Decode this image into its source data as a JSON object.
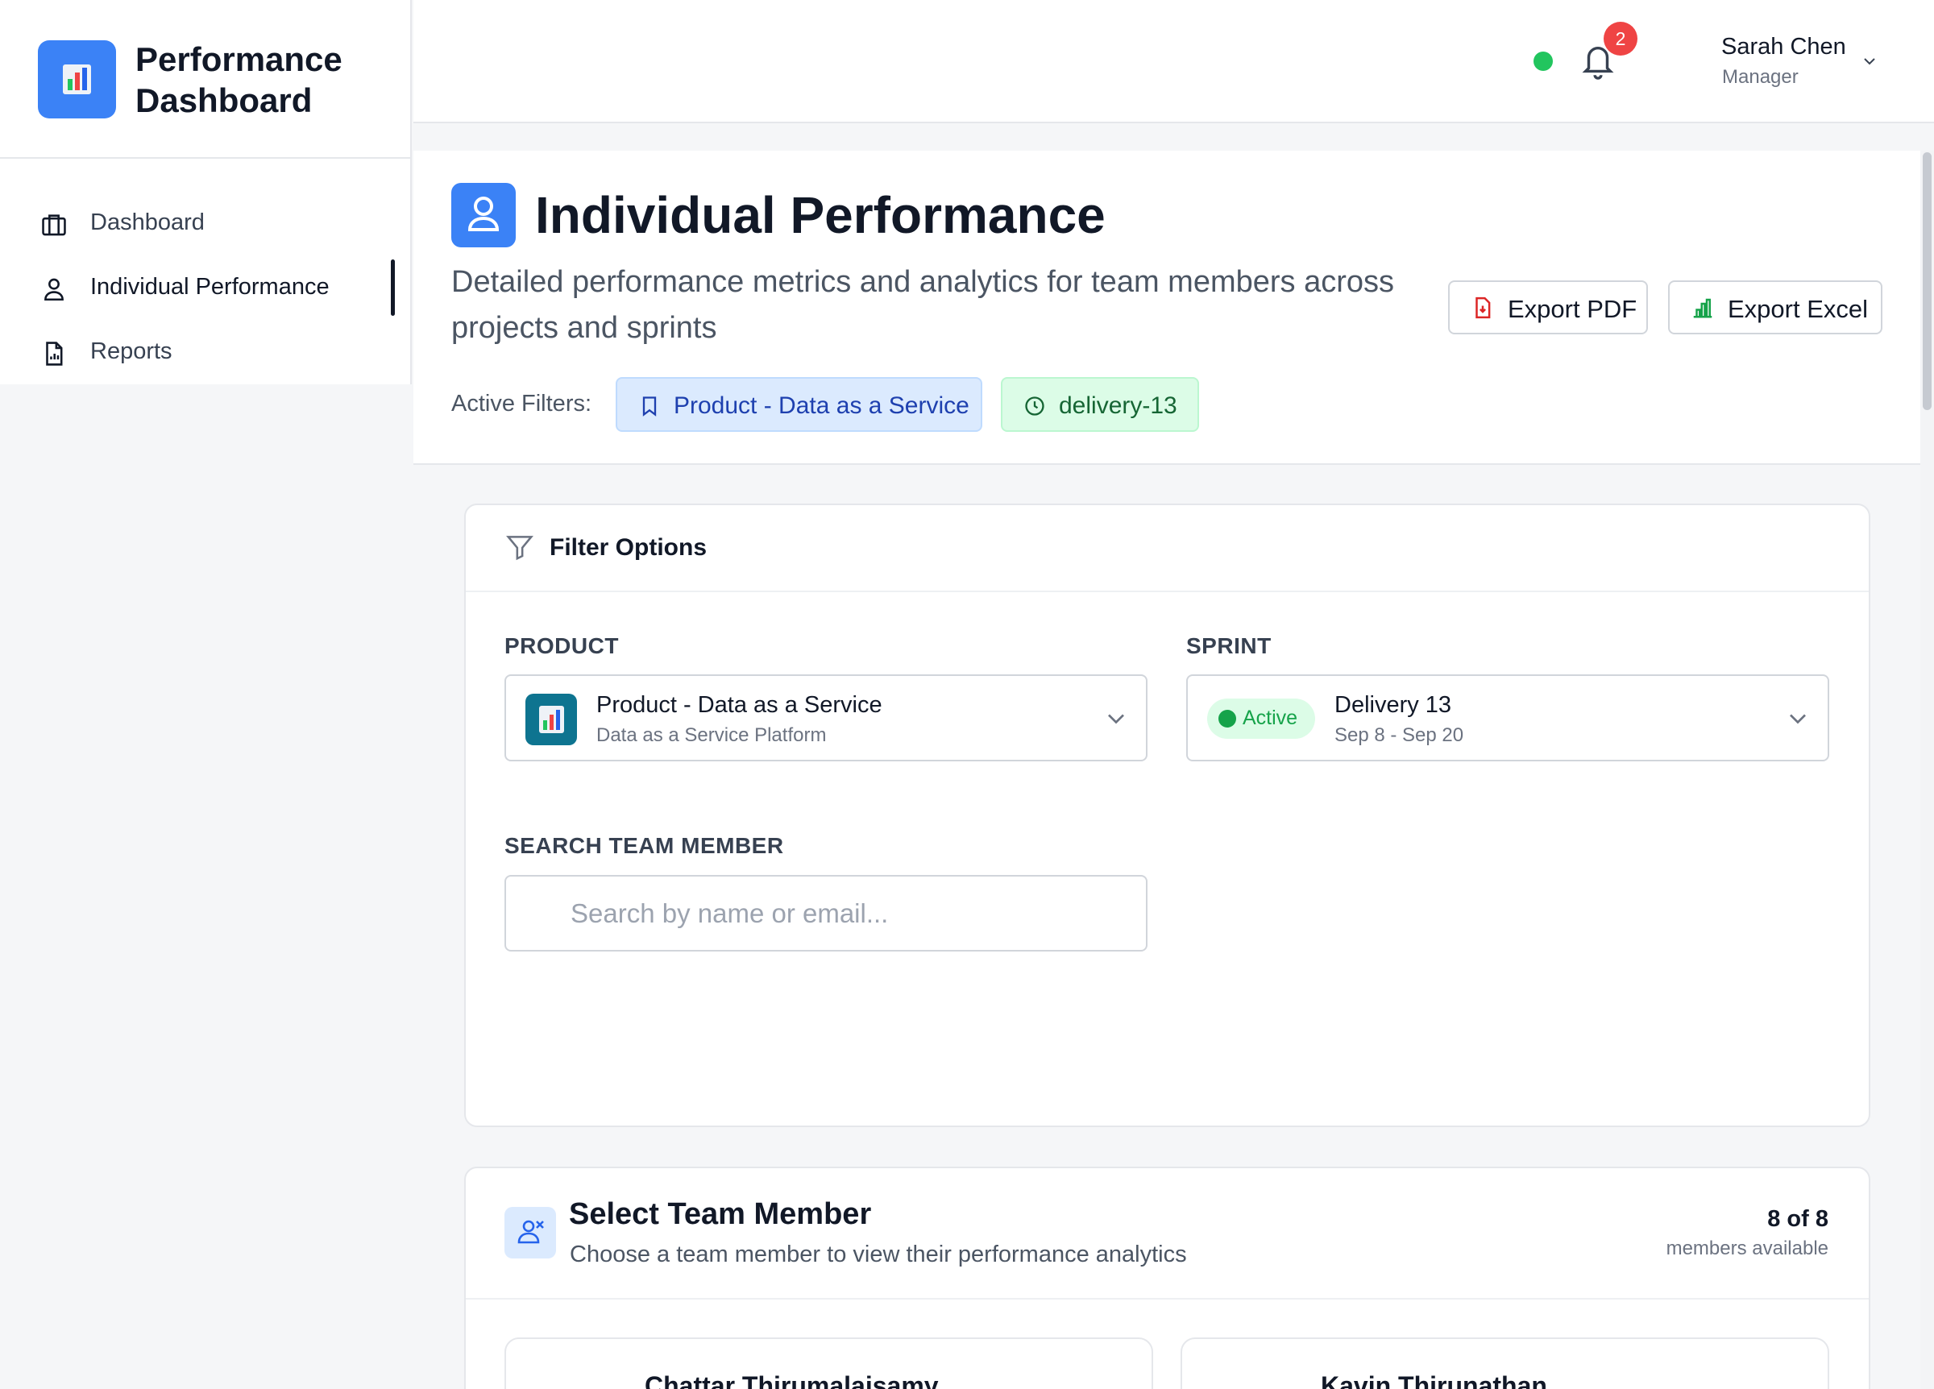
{
  "brand": {
    "title": "Performance Dashboard"
  },
  "sidebar": {
    "items": [
      {
        "label": "Dashboard",
        "icon": "briefcase-icon",
        "active": false
      },
      {
        "label": "Individual Performance",
        "icon": "user-icon",
        "active": true
      },
      {
        "label": "Reports",
        "icon": "document-chart-icon",
        "active": false
      }
    ]
  },
  "header": {
    "status": "online",
    "notifications_count": "2",
    "user_name": "Sarah Chen",
    "user_role": "Manager"
  },
  "page": {
    "title": "Individual Performance",
    "description": "Detailed performance metrics and analytics for team members across projects and sprints",
    "export_pdf": "Export PDF",
    "export_excel": "Export Excel",
    "active_filters_label": "Active Filters:",
    "active_filters": [
      "Product - Data as a Service",
      "delivery-13"
    ]
  },
  "filter_options": {
    "title": "Filter Options",
    "product_label": "PRODUCT",
    "product_value": "Product - Data as a Service",
    "product_sub": "Data as a Service Platform",
    "sprint_label": "SPRINT",
    "sprint_status": "Active",
    "sprint_value": "Delivery 13",
    "sprint_dates": "Sep 8 - Sep 20",
    "search_label": "SEARCH TEAM MEMBER",
    "search_placeholder": "Search by name or email...",
    "search_value": ""
  },
  "team": {
    "title": "Select Team Member",
    "subtitle": "Choose a team member to view their performance analytics",
    "count": "8 of 8",
    "count_label": "members available",
    "members": [
      {
        "name": "Chattar Thirumalaisamy"
      },
      {
        "name": "Kavin Thirunathan"
      }
    ]
  },
  "colors": {
    "accent": "#3b82f6",
    "status_green": "#22c55e",
    "badge_red": "#ef4444",
    "chip_blue_bg": "#dbeafe",
    "chip_green_bg": "#dcfce7"
  }
}
